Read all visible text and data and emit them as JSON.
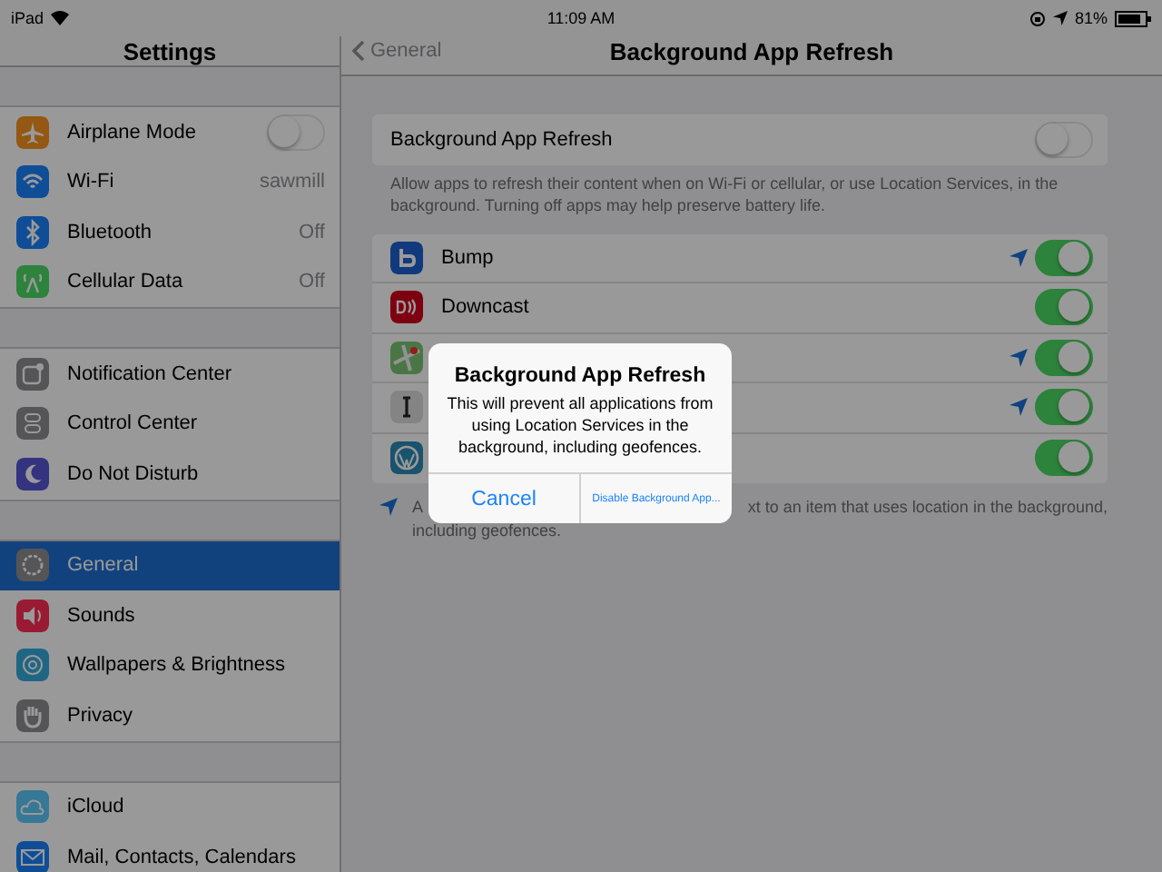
{
  "status_bar": {
    "device": "iPad",
    "time": "11:09 AM",
    "battery": "81%"
  },
  "sidebar": {
    "title": "Settings",
    "groups": [
      {
        "items": [
          {
            "label": "Airplane Mode",
            "kind": "switch",
            "on": false,
            "selected": false
          },
          {
            "label": "Wi-Fi",
            "kind": "value",
            "value": "sawmill",
            "selected": false
          },
          {
            "label": "Bluetooth",
            "kind": "value",
            "value": "Off",
            "selected": false
          },
          {
            "label": "Cellular Data",
            "kind": "value",
            "value": "Off",
            "selected": false
          }
        ]
      },
      {
        "items": [
          {
            "label": "Notification Center",
            "kind": "plain",
            "selected": false
          },
          {
            "label": "Control Center",
            "kind": "plain",
            "selected": false
          },
          {
            "label": "Do Not Disturb",
            "kind": "plain",
            "selected": false
          }
        ]
      },
      {
        "items": [
          {
            "label": "General",
            "kind": "plain",
            "selected": true
          },
          {
            "label": "Sounds",
            "kind": "plain",
            "selected": false
          },
          {
            "label": "Wallpapers & Brightness",
            "kind": "plain",
            "selected": false
          },
          {
            "label": "Privacy",
            "kind": "plain",
            "selected": false
          }
        ]
      },
      {
        "items": [
          {
            "label": "iCloud",
            "kind": "plain",
            "selected": false
          },
          {
            "label": "Mail, Contacts, Calendars",
            "kind": "plain",
            "selected": false
          }
        ]
      }
    ]
  },
  "detail": {
    "back": "General",
    "title": "Background App Refresh",
    "master": {
      "label": "Background App Refresh",
      "on": false
    },
    "description": "Allow apps to refresh their content when on Wi-Fi or cellular, or use Location Services, in the background. Turning off apps may help preserve battery life.",
    "apps": [
      {
        "name": "Bump",
        "location": true,
        "on": true
      },
      {
        "name": "Downcast",
        "location": false,
        "on": true
      },
      {
        "location": true,
        "on": true
      },
      {
        "location": true,
        "on": true
      },
      {
        "location": false,
        "on": true
      }
    ],
    "footnote": {
      "start": "A",
      "end": "xt to an item that uses location in the background,",
      "line_2": "including geofences."
    }
  },
  "alert": {
    "title": "Background App Refresh",
    "message": "This will prevent all applications from using Location Services in the background, including geofences.",
    "buttons": [
      "Cancel",
      "Disable Background App..."
    ]
  }
}
